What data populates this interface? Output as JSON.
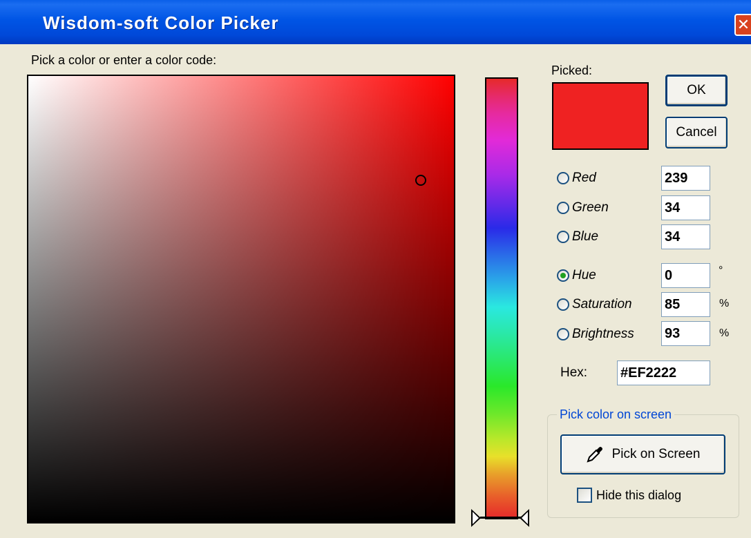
{
  "window": {
    "title": "Wisdom-soft Color Picker",
    "close_icon": "close-icon"
  },
  "prompt": "Pick a color or enter a color code:",
  "picked": {
    "label": "Picked:",
    "color": "#EF2222"
  },
  "buttons": {
    "ok": "OK",
    "cancel": "Cancel",
    "pick_on_screen": "Pick on Screen"
  },
  "channels": [
    {
      "label": "Red",
      "value": "239",
      "unit": "",
      "selected": false
    },
    {
      "label": "Green",
      "value": "34",
      "unit": "",
      "selected": false
    },
    {
      "label": "Blue",
      "value": "34",
      "unit": "",
      "selected": false
    },
    {
      "label": "Hue",
      "value": "0",
      "unit": "°",
      "selected": true
    },
    {
      "label": "Saturation",
      "value": "85",
      "unit": "%",
      "selected": false
    },
    {
      "label": "Brightness",
      "value": "93",
      "unit": "%",
      "selected": false
    }
  ],
  "hex": {
    "label": "Hex:",
    "value": "#EF2222"
  },
  "pick_screen_group": {
    "title": "Pick color on screen",
    "icon": "eyedropper-icon",
    "hide_dialog_label": "Hide this dialog",
    "hide_dialog_checked": false
  },
  "colors": {
    "titlebar": "#0055e5",
    "dialog_bg": "#ece9d8",
    "selected_radio": "#21a121"
  }
}
